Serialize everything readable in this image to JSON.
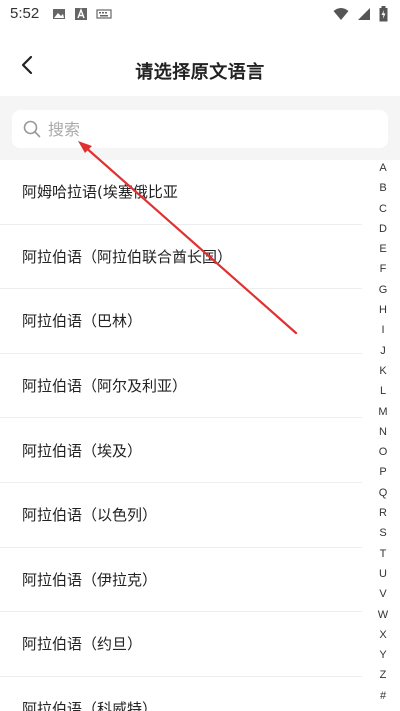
{
  "status_bar": {
    "time": "5:52",
    "left_icons": [
      "image-icon",
      "text-a-icon",
      "keyboard-icon"
    ],
    "right_icons": [
      "wifi-icon",
      "signal-icon",
      "battery-charging-icon"
    ]
  },
  "header": {
    "title": "请选择原文语言",
    "back_icon": "chevron-left-icon"
  },
  "search": {
    "placeholder": "搜索",
    "value": ""
  },
  "languages": [
    "阿姆哈拉语(埃塞俄比亚",
    "阿拉伯语（阿拉伯联合酋长国）",
    "阿拉伯语（巴林）",
    "阿拉伯语（阿尔及利亚）",
    "阿拉伯语（埃及）",
    "阿拉伯语（以色列）",
    "阿拉伯语（伊拉克）",
    "阿拉伯语（约旦）",
    "阿拉伯语（科威特）"
  ],
  "alphabet": [
    "A",
    "B",
    "C",
    "D",
    "E",
    "F",
    "G",
    "H",
    "I",
    "J",
    "K",
    "L",
    "M",
    "N",
    "O",
    "P",
    "Q",
    "R",
    "S",
    "T",
    "U",
    "V",
    "W",
    "X",
    "Y",
    "Z",
    "#"
  ],
  "colors": {
    "annotation_arrow": "#e03030",
    "search_bg": "#f5f5f5",
    "divider": "#eeeeee"
  }
}
